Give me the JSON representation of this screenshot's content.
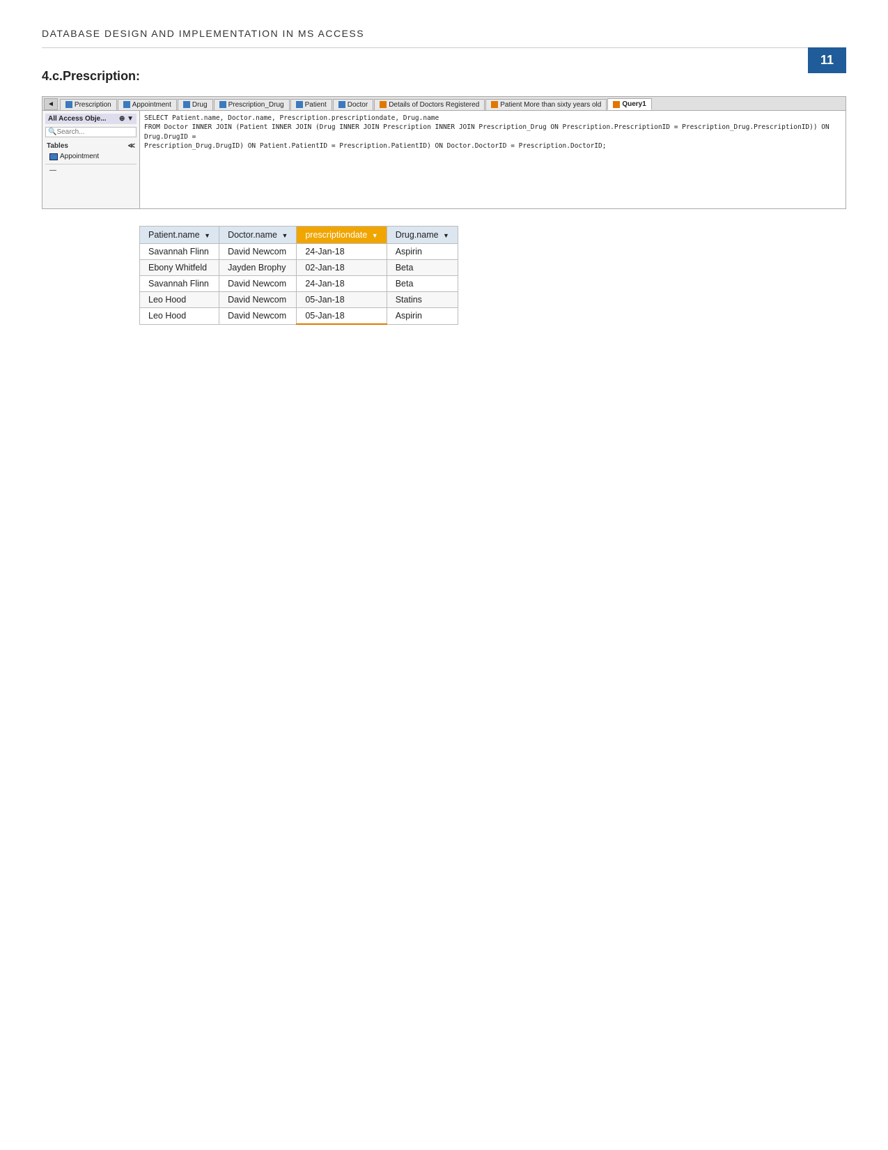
{
  "page": {
    "number": "11",
    "header_title": "DATABASE DESIGN AND IMPLEMENTATION IN MS ACCESS"
  },
  "section": {
    "title": "4.c.Prescription:"
  },
  "access": {
    "tabs": [
      {
        "label": "Prescription",
        "icon": "table",
        "active": false
      },
      {
        "label": "Appointment",
        "icon": "table",
        "active": false
      },
      {
        "label": "Drug",
        "icon": "table",
        "active": false
      },
      {
        "label": "Prescription_Drug",
        "icon": "table",
        "active": false
      },
      {
        "label": "Patient",
        "icon": "table",
        "active": false
      },
      {
        "label": "Doctor",
        "icon": "table",
        "active": false
      },
      {
        "label": "Details of Doctors Registered",
        "icon": "query",
        "active": false
      },
      {
        "label": "Patient More than sixty years old",
        "icon": "query",
        "active": false
      },
      {
        "label": "Query1",
        "icon": "query",
        "active": true
      }
    ],
    "sidebar": {
      "header": "All Access Obje...",
      "search_placeholder": "Search...",
      "sections": [
        {
          "label": "Tables",
          "items": [
            "Appointment"
          ]
        }
      ]
    },
    "sql": {
      "line1": "SELECT Patient.name, Doctor.name, Prescription.prescriptiondate, Drug.name",
      "line2": "FROM Doctor INNER JOIN (Patient INNER JOIN (Drug INNER JOIN Prescription INNER JOIN Prescription_Drug ON Prescription.PrescriptionID = Prescription_Drug.PrescriptionID)) ON Drug.DrugID =",
      "line3": "Prescription_Drug.DrugID) ON Patient.PatientID = Prescription.PatientID) ON Doctor.DoctorID = Prescription.DoctorID;"
    }
  },
  "results_table": {
    "columns": [
      {
        "label": "Patient.name",
        "highlight": false
      },
      {
        "label": "Doctor.name",
        "highlight": false
      },
      {
        "label": "prescriptiondate",
        "highlight": true
      },
      {
        "label": "Drug.name",
        "highlight": false
      }
    ],
    "rows": [
      {
        "patient": "Savannah Flinn",
        "doctor": "David Newcom",
        "date": "24-Jan-18",
        "drug": "Aspirin",
        "underline": false
      },
      {
        "patient": "Ebony Whitfeld",
        "doctor": "Jayden Brophy",
        "date": "02-Jan-18",
        "drug": "Beta",
        "underline": false
      },
      {
        "patient": "Savannah Flinn",
        "doctor": "David Newcom",
        "date": "24-Jan-18",
        "drug": "Beta",
        "underline": false
      },
      {
        "patient": "Leo Hood",
        "doctor": "David Newcom",
        "date": "05-Jan-18",
        "drug": "Statins",
        "underline": false
      },
      {
        "patient": "Leo Hood",
        "doctor": "David Newcom",
        "date": "05-Jan-18",
        "drug": "Aspirin",
        "underline": true
      }
    ]
  }
}
